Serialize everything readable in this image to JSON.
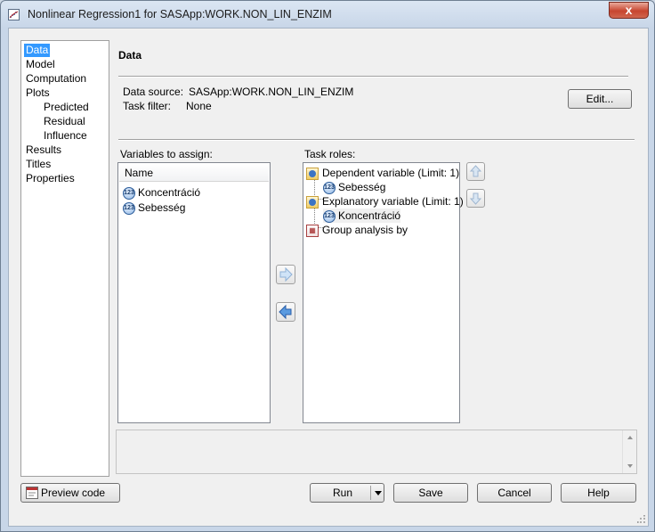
{
  "window": {
    "title": "Nonlinear Regression1 for SASApp:WORK.NON_LIN_ENZIM",
    "close_label": "x"
  },
  "nav": {
    "items": [
      {
        "label": "Data",
        "selected": true
      },
      {
        "label": "Model"
      },
      {
        "label": "Computation"
      },
      {
        "label": "Plots"
      },
      {
        "label": "Predicted"
      },
      {
        "label": "Residual"
      },
      {
        "label": "Influence"
      },
      {
        "label": "Results"
      },
      {
        "label": "Titles"
      },
      {
        "label": "Properties"
      }
    ]
  },
  "data_page": {
    "heading": "Data",
    "data_source_label": "Data source:",
    "data_source_value": "SASApp:WORK.NON_LIN_ENZIM",
    "task_filter_label": "Task filter:",
    "task_filter_value": "None",
    "edit_button": "Edit...",
    "variables_label": "Variables to assign:",
    "variables_column_header": "Name",
    "variables": [
      "Koncentráció",
      "Sebesség"
    ],
    "roles_label": "Task roles:",
    "roles": [
      {
        "label": "Dependent variable  (Limit: 1)",
        "assigned": "Sebesség"
      },
      {
        "label": "Explanatory variable  (Limit: 1)",
        "assigned": "Koncentráció"
      },
      {
        "label": "Group analysis by"
      }
    ]
  },
  "footer": {
    "preview_code": "Preview code",
    "run": "Run",
    "save": "Save",
    "cancel": "Cancel",
    "help": "Help"
  },
  "colors": {
    "selection": "#3399ff",
    "close_button": "#c7452f"
  }
}
